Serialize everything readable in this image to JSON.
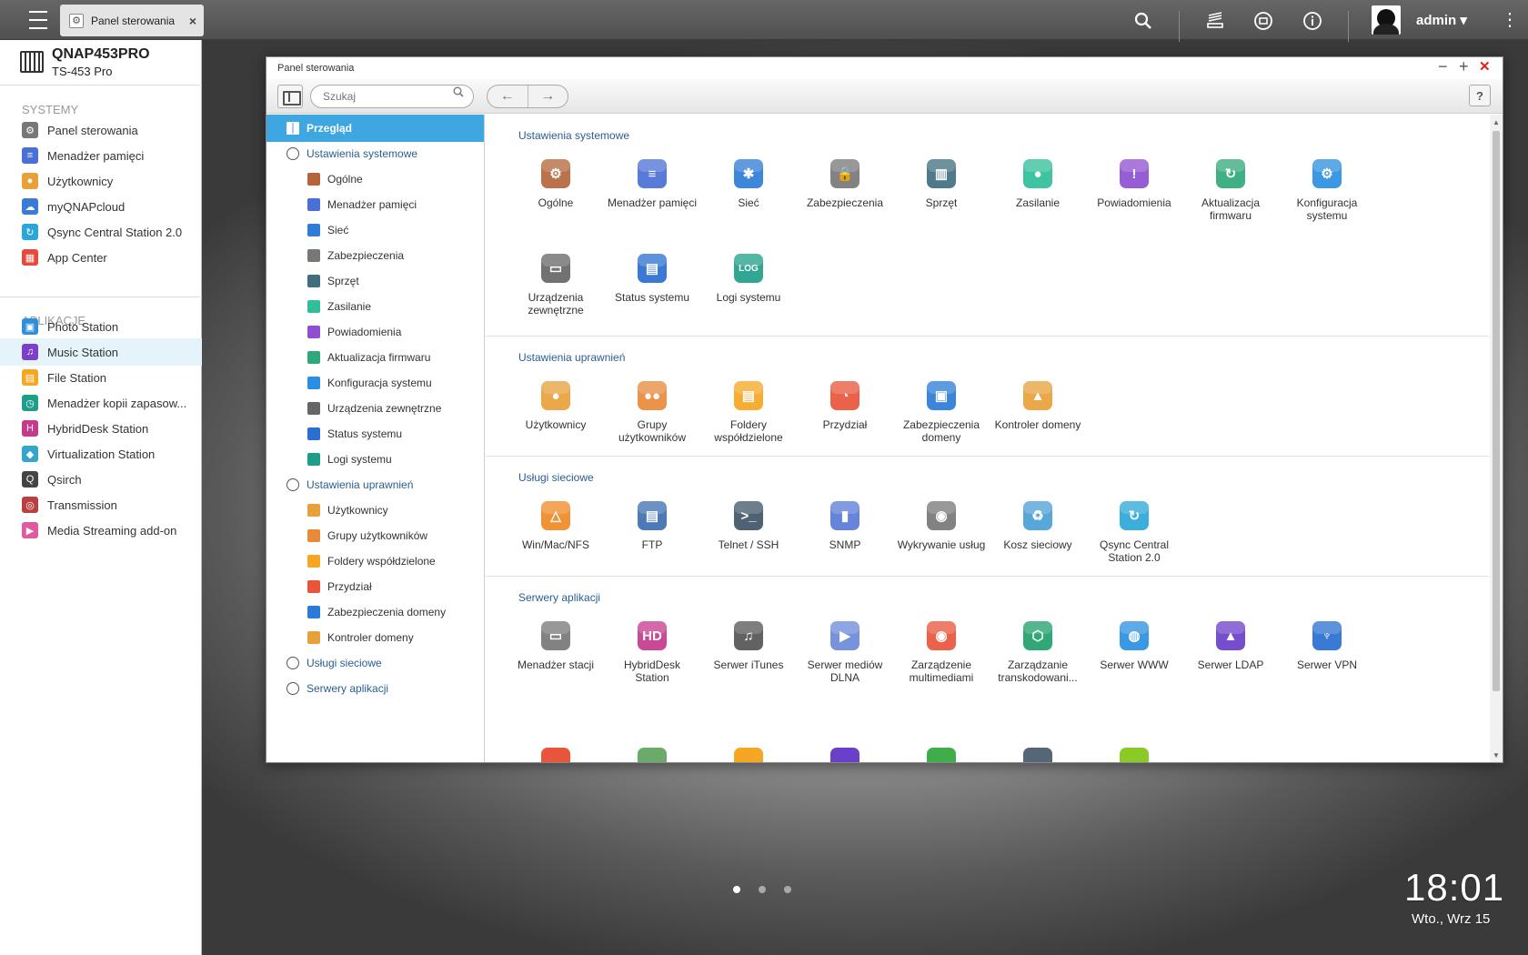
{
  "top_bar": {
    "tab_title": "Panel sterowania",
    "tab_close": "×",
    "user": "admin ▾",
    "icons": [
      "search-icon",
      "stack-icon",
      "sync-icon",
      "info-icon"
    ]
  },
  "left_panel": {
    "device_name": "QNAP453PRO",
    "device_model": "TS-453 Pro",
    "systems_header": "SYSTEMY",
    "systems": [
      {
        "label": "Panel sterowania",
        "color": "#777777",
        "glyph": "⚙"
      },
      {
        "label": "Menadżer pamięci",
        "color": "#4a6fd6",
        "glyph": "≡"
      },
      {
        "label": "Użytkownicy",
        "color": "#e8a13a",
        "glyph": "●"
      },
      {
        "label": "myQNAPcloud",
        "color": "#3b7bd8",
        "glyph": "☁"
      },
      {
        "label": "Qsync Central Station 2.0",
        "color": "#2aa7d8",
        "glyph": "↻"
      },
      {
        "label": "App Center",
        "color": "#e64a3a",
        "glyph": "▦"
      }
    ],
    "apps_header": "APLIKACJE",
    "apps": [
      {
        "label": "Photo Station",
        "color": "#2f8fd8",
        "glyph": "▣"
      },
      {
        "label": "Music Station",
        "color": "#7c3fc9",
        "glyph": "♫"
      },
      {
        "label": "File Station",
        "color": "#f5a623",
        "glyph": "▤"
      },
      {
        "label": "Menadżer kopii zapasow...",
        "color": "#1e9e8a",
        "glyph": "◷"
      },
      {
        "label": "HybridDesk Station",
        "color": "#c53a8d",
        "glyph": "H"
      },
      {
        "label": "Virtualization Station",
        "color": "#35a6c9",
        "glyph": "◆"
      },
      {
        "label": "Qsirch",
        "color": "#444444",
        "glyph": "Q"
      },
      {
        "label": "Transmission",
        "color": "#b84040",
        "glyph": "◎"
      },
      {
        "label": "Media Streaming add-on",
        "color": "#e05aa0",
        "glyph": "▶"
      }
    ]
  },
  "window": {
    "title": "Panel sterowania",
    "search_placeholder": "Szukaj",
    "back": "←",
    "forward": "→",
    "help": "?",
    "minimize": "−",
    "maximize": "+",
    "close": "✕",
    "nav": [
      {
        "label": "Przegląd",
        "level": 1,
        "selected": true,
        "color": "#ffffff"
      },
      {
        "label": "Ustawienia systemowe",
        "level": 1,
        "color": "#555555"
      },
      {
        "label": "Ogólne",
        "level": 2,
        "color": "#b5653a"
      },
      {
        "label": "Menadżer pamięci",
        "level": 2,
        "color": "#4a6fd6"
      },
      {
        "label": "Sieć",
        "level": 2,
        "color": "#2e7cd6"
      },
      {
        "label": "Zabezpieczenia",
        "level": 2,
        "color": "#777777"
      },
      {
        "label": "Sprzęt",
        "level": 2,
        "color": "#3f6f7f"
      },
      {
        "label": "Zasilanie",
        "level": 2,
        "color": "#2fbf9a"
      },
      {
        "label": "Powiadomienia",
        "level": 2,
        "color": "#8e4fd1"
      },
      {
        "label": "Aktualizacja firmwaru",
        "level": 2,
        "color": "#2fa87a"
      },
      {
        "label": "Konfiguracja systemu",
        "level": 2,
        "color": "#2a8fe0"
      },
      {
        "label": "Urządzenia zewnętrzne",
        "level": 2,
        "color": "#666666"
      },
      {
        "label": "Status systemu",
        "level": 2,
        "color": "#2a6fd0"
      },
      {
        "label": "Logi systemu",
        "level": 2,
        "color": "#1e9e8a"
      },
      {
        "label": "Ustawienia uprawnień",
        "level": 1,
        "color": "#555555"
      },
      {
        "label": "Użytkownicy",
        "level": 2,
        "color": "#e8a13a"
      },
      {
        "label": "Grupy użytkowników",
        "level": 2,
        "color": "#e88a3a"
      },
      {
        "label": "Foldery współdzielone",
        "level": 2,
        "color": "#f5a623"
      },
      {
        "label": "Przydział",
        "level": 2,
        "color": "#e8553a"
      },
      {
        "label": "Zabezpieczenia domeny",
        "level": 2,
        "color": "#2a7bd8"
      },
      {
        "label": "Kontroler domeny",
        "level": 2,
        "color": "#e8a13a"
      },
      {
        "label": "Usługi sieciowe",
        "level": 1,
        "color": "#555555"
      },
      {
        "label": "Serwery aplikacji",
        "level": 1,
        "color": "#555555"
      }
    ],
    "sections": [
      {
        "title": "Ustawienia systemowe",
        "items": [
          {
            "label": "Ogólne",
            "color": "#b5653a",
            "glyph": "⚙"
          },
          {
            "label": "Menadżer pamięci",
            "color": "#4a6fd6",
            "glyph": "≡"
          },
          {
            "label": "Sieć",
            "color": "#2e7cd6",
            "glyph": "✱"
          },
          {
            "label": "Zabezpieczenia",
            "color": "#777777",
            "glyph": "🔒"
          },
          {
            "label": "Sprzęt",
            "color": "#3f6f7f",
            "glyph": "▥"
          },
          {
            "label": "Zasilanie",
            "color": "#2fbf9a",
            "glyph": "●"
          },
          {
            "label": "Powiadomienia",
            "color": "#8e4fd1",
            "glyph": "!"
          },
          {
            "label": "Aktualizacja firmwaru",
            "color": "#2fa87a",
            "glyph": "↻"
          },
          {
            "label": "Konfiguracja systemu",
            "color": "#2a8fe0",
            "glyph": "⚙"
          },
          {
            "label": "Urządzenia zewnętrzne",
            "color": "#666666",
            "glyph": "▭"
          },
          {
            "label": "Status systemu",
            "color": "#2a6fd0",
            "glyph": "▤"
          },
          {
            "label": "Logi systemu",
            "color": "#1e9e8a",
            "glyph": "LOG"
          }
        ]
      },
      {
        "title": "Ustawienia uprawnień",
        "items": [
          {
            "label": "Użytkownicy",
            "color": "#e8a13a",
            "glyph": "●"
          },
          {
            "label": "Grupy użytkowników",
            "color": "#e88a3a",
            "glyph": "●●"
          },
          {
            "label": "Foldery współdzielone",
            "color": "#f5a623",
            "glyph": "▤"
          },
          {
            "label": "Przydział",
            "color": "#e8553a",
            "glyph": "◔"
          },
          {
            "label": "Zabezpieczenia domeny",
            "color": "#2a7bd8",
            "glyph": "▣"
          },
          {
            "label": "Kontroler domeny",
            "color": "#e8a13a",
            "glyph": "▲"
          }
        ]
      },
      {
        "title": "Usługi sieciowe",
        "items": [
          {
            "label": "Win/Mac/NFS",
            "color": "#f08a24",
            "glyph": "△"
          },
          {
            "label": "FTP",
            "color": "#3c6fb0",
            "glyph": "▤"
          },
          {
            "label": "Telnet / SSH",
            "color": "#3f5568",
            "glyph": ">_"
          },
          {
            "label": "SNMP",
            "color": "#5a7ad8",
            "glyph": "▮"
          },
          {
            "label": "Wykrywanie usług",
            "color": "#777777",
            "glyph": "◉"
          },
          {
            "label": "Kosz sieciowy",
            "color": "#4a9fd8",
            "glyph": "♻"
          },
          {
            "label": "Qsync Central Station 2.0",
            "color": "#2aa7d8",
            "glyph": "↻"
          }
        ]
      },
      {
        "title": "Serwery aplikacji",
        "items": [
          {
            "label": "Menadżer stacji",
            "color": "#777777",
            "glyph": "▭"
          },
          {
            "label": "HybridDesk Station",
            "color": "#c53a8d",
            "glyph": "HD"
          },
          {
            "label": "Serwer iTunes",
            "color": "#555555",
            "glyph": "♫"
          },
          {
            "label": "Serwer mediów DLNA",
            "color": "#6a8ad8",
            "glyph": "▶"
          },
          {
            "label": "Zarządzenie multimediami",
            "color": "#e8553a",
            "glyph": "◉"
          },
          {
            "label": "Zarządzanie transkodowani...",
            "color": "#1ea06a",
            "glyph": "⬡"
          },
          {
            "label": "Serwer WWW",
            "color": "#2a8fe0",
            "glyph": "◍"
          },
          {
            "label": "Serwer LDAP",
            "color": "#6a3fc9",
            "glyph": "▲"
          },
          {
            "label": "Serwer VPN",
            "color": "#2a6fd0",
            "glyph": "♆"
          }
        ]
      }
    ],
    "peek_icons": [
      {
        "color": "#e8553a"
      },
      {
        "color": "#6aaa6a"
      },
      {
        "color": "#f5a623"
      },
      {
        "color": "#6a3fc9"
      },
      {
        "color": "#3fae4a"
      },
      {
        "color": "#556677"
      },
      {
        "color": "#8ac926"
      }
    ]
  },
  "desktop": {
    "time": "18:01",
    "date": "Wto., Wrz 15"
  }
}
